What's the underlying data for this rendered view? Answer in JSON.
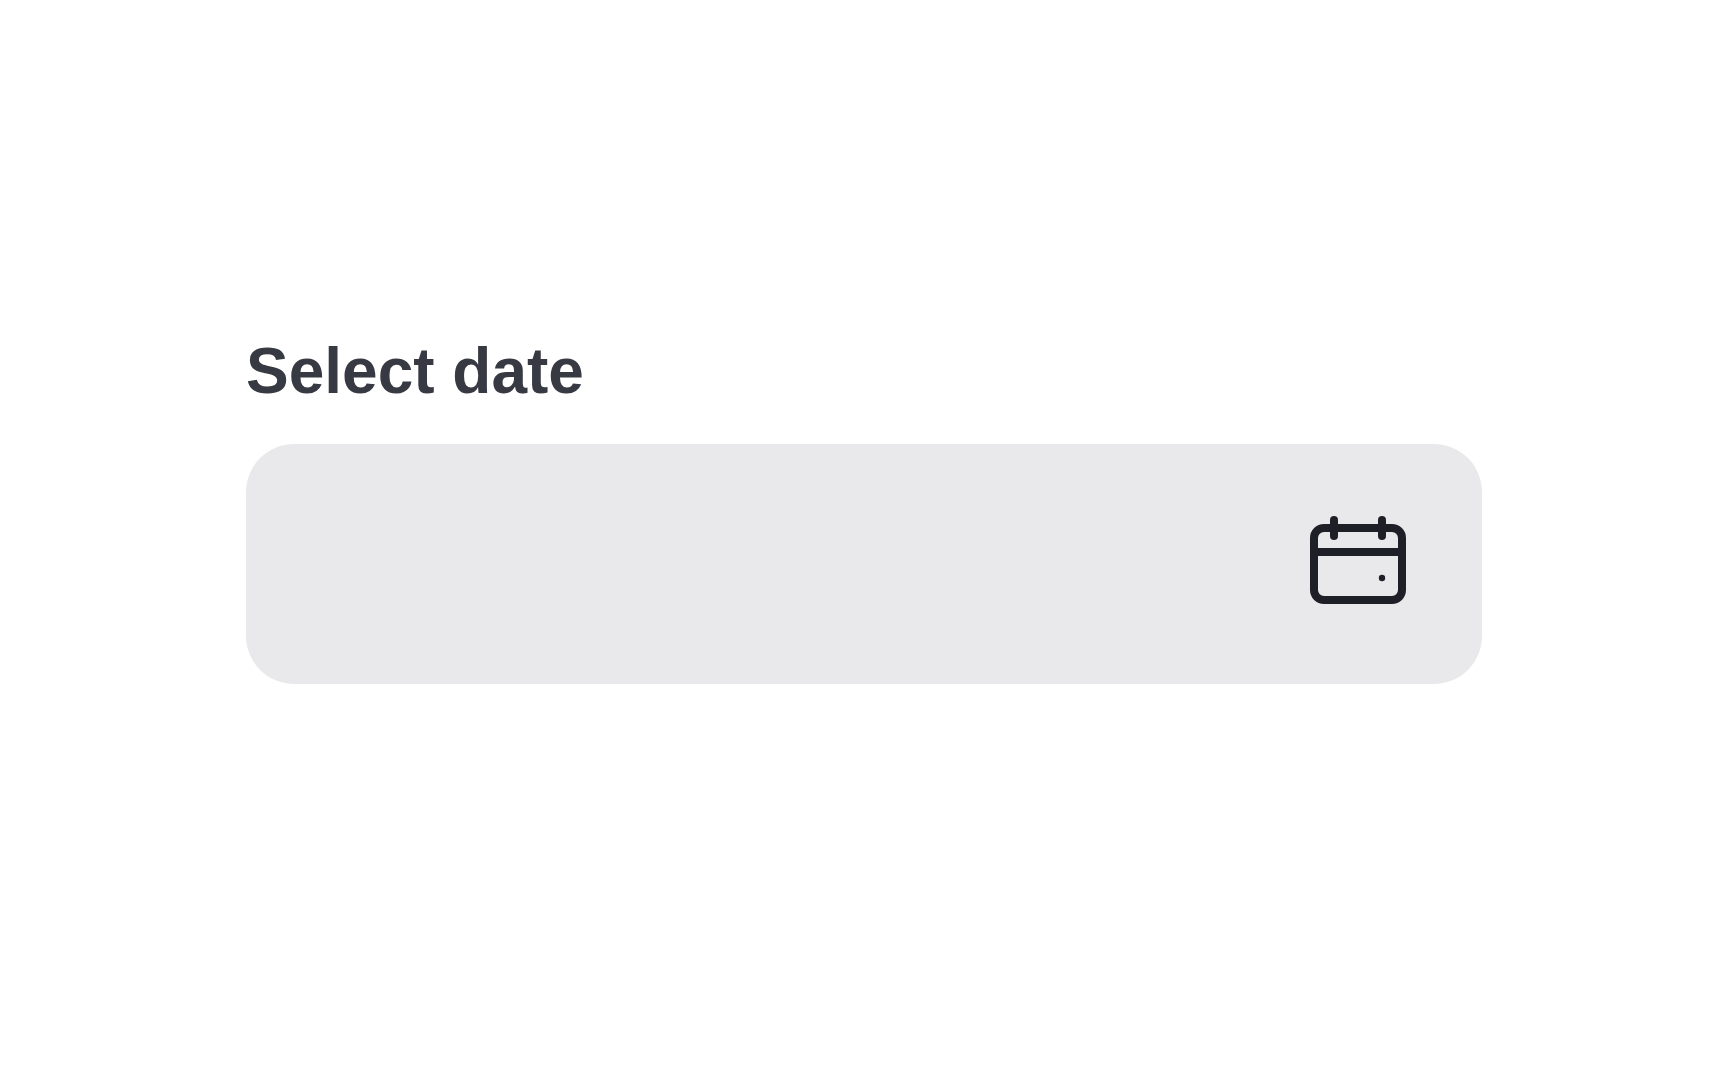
{
  "label": "Select date"
}
